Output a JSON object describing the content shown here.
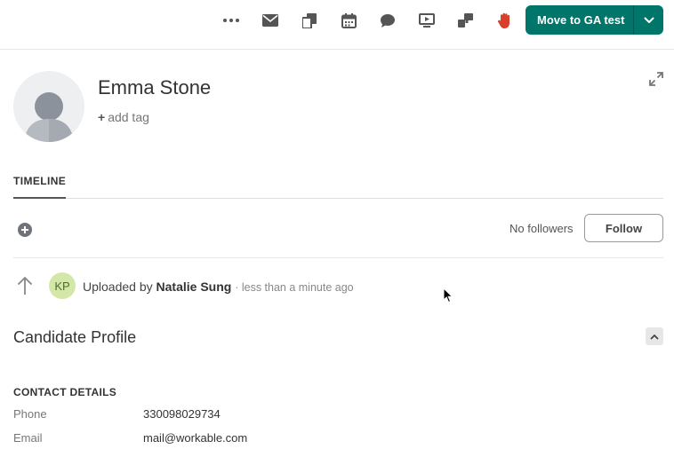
{
  "toolbar": {
    "icons": [
      "more-icon",
      "mail-icon",
      "copy-icon",
      "calendar-icon",
      "comment-icon",
      "video-icon",
      "puzzle-icon",
      "hand-icon"
    ],
    "move_button_label": "Move to GA test"
  },
  "candidate": {
    "name": "Emma Stone",
    "add_tag": "add tag"
  },
  "tabs": {
    "timeline": "TIMELINE"
  },
  "followers": {
    "status": "No followers",
    "follow_label": "Follow"
  },
  "activity": {
    "initials": "KP",
    "prefix": "Uploaded by",
    "user": "Natalie Sung",
    "time": "· less than a minute ago"
  },
  "profile": {
    "title": "Candidate Profile",
    "contact_header": "CONTACT DETAILS",
    "phone_label": "Phone",
    "phone_value": "330098029734",
    "email_label": "Email",
    "email_value": "mail@workable.com"
  },
  "colors": {
    "primary": "#00756a",
    "hand_icon": "#d9402b",
    "initials_bg": "#d3e8a8"
  }
}
